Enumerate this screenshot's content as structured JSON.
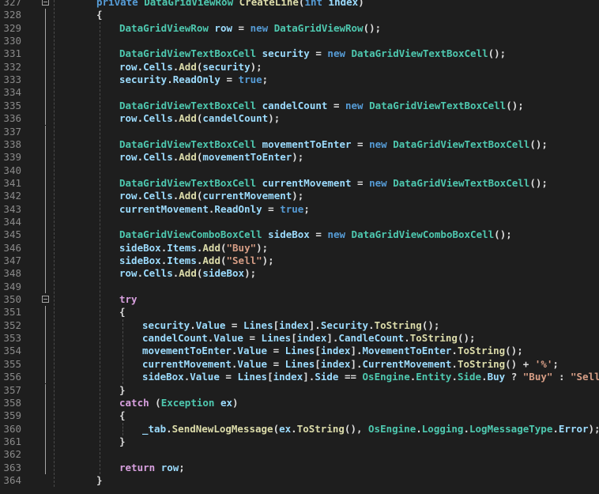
{
  "editor": {
    "language": "C#",
    "colors": {
      "background": "#1e1e1e",
      "line_number": "#8a8a8a",
      "type": "#4ec9b0",
      "keyword": "#569cd6",
      "control": "#d8a0df",
      "method": "#dcdcaa",
      "variable": "#9cdcfe",
      "string": "#d69d85",
      "plain": "#dcdcdc"
    },
    "line_numbers": [
      "327",
      "328",
      "329",
      "330",
      "331",
      "332",
      "333",
      "334",
      "335",
      "336",
      "337",
      "338",
      "339",
      "340",
      "341",
      "342",
      "343",
      "344",
      "345",
      "346",
      "347",
      "348",
      "349",
      "350",
      "351",
      "352",
      "353",
      "354",
      "355",
      "356",
      "357",
      "358",
      "359",
      "360",
      "361",
      "362",
      "363",
      "364"
    ],
    "fold_markers": [
      "327",
      "350"
    ],
    "lines": [
      [
        [
          "kw",
          "private "
        ],
        [
          "type",
          "DataGridViewRow "
        ],
        [
          "method",
          "CreateLine"
        ],
        [
          "plain",
          "("
        ],
        [
          "kw",
          "int "
        ],
        [
          "var",
          "index"
        ],
        [
          "plain",
          ")"
        ]
      ],
      [
        [
          "plain",
          "{"
        ]
      ],
      [
        [
          "type",
          "DataGridViewRow "
        ],
        [
          "var",
          "row "
        ],
        [
          "plain",
          "= "
        ],
        [
          "kw",
          "new "
        ],
        [
          "type",
          "DataGridViewRow"
        ],
        [
          "plain",
          "();"
        ]
      ],
      [],
      [
        [
          "type",
          "DataGridViewTextBoxCell "
        ],
        [
          "var",
          "security "
        ],
        [
          "plain",
          "= "
        ],
        [
          "kw",
          "new "
        ],
        [
          "type",
          "DataGridViewTextBoxCell"
        ],
        [
          "plain",
          "();"
        ]
      ],
      [
        [
          "var",
          "row"
        ],
        [
          "plain",
          "."
        ],
        [
          "var",
          "Cells"
        ],
        [
          "plain",
          "."
        ],
        [
          "method",
          "Add"
        ],
        [
          "plain",
          "("
        ],
        [
          "var",
          "security"
        ],
        [
          "plain",
          ");"
        ]
      ],
      [
        [
          "var",
          "security"
        ],
        [
          "plain",
          "."
        ],
        [
          "var",
          "ReadOnly "
        ],
        [
          "plain",
          "= "
        ],
        [
          "kw",
          "true"
        ],
        [
          "plain",
          ";"
        ]
      ],
      [],
      [
        [
          "type",
          "DataGridViewTextBoxCell "
        ],
        [
          "var",
          "candelCount "
        ],
        [
          "plain",
          "= "
        ],
        [
          "kw",
          "new "
        ],
        [
          "type",
          "DataGridViewTextBoxCell"
        ],
        [
          "plain",
          "();"
        ]
      ],
      [
        [
          "var",
          "row"
        ],
        [
          "plain",
          "."
        ],
        [
          "var",
          "Cells"
        ],
        [
          "plain",
          "."
        ],
        [
          "method",
          "Add"
        ],
        [
          "plain",
          "("
        ],
        [
          "var",
          "candelCount"
        ],
        [
          "plain",
          ");"
        ]
      ],
      [],
      [
        [
          "type",
          "DataGridViewTextBoxCell "
        ],
        [
          "var",
          "movementToEnter "
        ],
        [
          "plain",
          "= "
        ],
        [
          "kw",
          "new "
        ],
        [
          "type",
          "DataGridViewTextBoxCell"
        ],
        [
          "plain",
          "();"
        ]
      ],
      [
        [
          "var",
          "row"
        ],
        [
          "plain",
          "."
        ],
        [
          "var",
          "Cells"
        ],
        [
          "plain",
          "."
        ],
        [
          "method",
          "Add"
        ],
        [
          "plain",
          "("
        ],
        [
          "var",
          "movementToEnter"
        ],
        [
          "plain",
          ");"
        ]
      ],
      [],
      [
        [
          "type",
          "DataGridViewTextBoxCell "
        ],
        [
          "var",
          "currentMovement "
        ],
        [
          "plain",
          "= "
        ],
        [
          "kw",
          "new "
        ],
        [
          "type",
          "DataGridViewTextBoxCell"
        ],
        [
          "plain",
          "();"
        ]
      ],
      [
        [
          "var",
          "row"
        ],
        [
          "plain",
          "."
        ],
        [
          "var",
          "Cells"
        ],
        [
          "plain",
          "."
        ],
        [
          "method",
          "Add"
        ],
        [
          "plain",
          "("
        ],
        [
          "var",
          "currentMovement"
        ],
        [
          "plain",
          ");"
        ]
      ],
      [
        [
          "var",
          "currentMovement"
        ],
        [
          "plain",
          "."
        ],
        [
          "var",
          "ReadOnly "
        ],
        [
          "plain",
          "= "
        ],
        [
          "kw",
          "true"
        ],
        [
          "plain",
          ";"
        ]
      ],
      [],
      [
        [
          "type",
          "DataGridViewComboBoxCell "
        ],
        [
          "var",
          "sideBox "
        ],
        [
          "plain",
          "= "
        ],
        [
          "kw",
          "new "
        ],
        [
          "type",
          "DataGridViewComboBoxCell"
        ],
        [
          "plain",
          "();"
        ]
      ],
      [
        [
          "var",
          "sideBox"
        ],
        [
          "plain",
          "."
        ],
        [
          "var",
          "Items"
        ],
        [
          "plain",
          "."
        ],
        [
          "method",
          "Add"
        ],
        [
          "plain",
          "("
        ],
        [
          "str",
          "\"Buy\""
        ],
        [
          "plain",
          ");"
        ]
      ],
      [
        [
          "var",
          "sideBox"
        ],
        [
          "plain",
          "."
        ],
        [
          "var",
          "Items"
        ],
        [
          "plain",
          "."
        ],
        [
          "method",
          "Add"
        ],
        [
          "plain",
          "("
        ],
        [
          "str",
          "\"Sell\""
        ],
        [
          "plain",
          ");"
        ]
      ],
      [
        [
          "var",
          "row"
        ],
        [
          "plain",
          "."
        ],
        [
          "var",
          "Cells"
        ],
        [
          "plain",
          "."
        ],
        [
          "method",
          "Add"
        ],
        [
          "plain",
          "("
        ],
        [
          "var",
          "sideBox"
        ],
        [
          "plain",
          ");"
        ]
      ],
      [],
      [
        [
          "ctrl",
          "try"
        ]
      ],
      [
        [
          "plain",
          "{"
        ]
      ],
      [
        [
          "var",
          "security"
        ],
        [
          "plain",
          "."
        ],
        [
          "var",
          "Value "
        ],
        [
          "plain",
          "= "
        ],
        [
          "var",
          "Lines"
        ],
        [
          "plain",
          "["
        ],
        [
          "var",
          "index"
        ],
        [
          "plain",
          "]."
        ],
        [
          "var",
          "Security"
        ],
        [
          "plain",
          "."
        ],
        [
          "method",
          "ToString"
        ],
        [
          "plain",
          "();"
        ]
      ],
      [
        [
          "var",
          "candelCount"
        ],
        [
          "plain",
          "."
        ],
        [
          "var",
          "Value "
        ],
        [
          "plain",
          "= "
        ],
        [
          "var",
          "Lines"
        ],
        [
          "plain",
          "["
        ],
        [
          "var",
          "index"
        ],
        [
          "plain",
          "]."
        ],
        [
          "var",
          "CandleCount"
        ],
        [
          "plain",
          "."
        ],
        [
          "method",
          "ToString"
        ],
        [
          "plain",
          "();"
        ]
      ],
      [
        [
          "var",
          "movementToEnter"
        ],
        [
          "plain",
          "."
        ],
        [
          "var",
          "Value "
        ],
        [
          "plain",
          "= "
        ],
        [
          "var",
          "Lines"
        ],
        [
          "plain",
          "["
        ],
        [
          "var",
          "index"
        ],
        [
          "plain",
          "]."
        ],
        [
          "var",
          "MovementToEnter"
        ],
        [
          "plain",
          "."
        ],
        [
          "method",
          "ToString"
        ],
        [
          "plain",
          "();"
        ]
      ],
      [
        [
          "var",
          "currentMovement"
        ],
        [
          "plain",
          "."
        ],
        [
          "var",
          "Value "
        ],
        [
          "plain",
          "= "
        ],
        [
          "var",
          "Lines"
        ],
        [
          "plain",
          "["
        ],
        [
          "var",
          "index"
        ],
        [
          "plain",
          "]."
        ],
        [
          "var",
          "CurrentMovement"
        ],
        [
          "plain",
          "."
        ],
        [
          "method",
          "ToString"
        ],
        [
          "plain",
          "() + "
        ],
        [
          "str",
          "'%'"
        ],
        [
          "plain",
          ";"
        ]
      ],
      [
        [
          "var",
          "sideBox"
        ],
        [
          "plain",
          "."
        ],
        [
          "var",
          "Value "
        ],
        [
          "plain",
          "= "
        ],
        [
          "var",
          "Lines"
        ],
        [
          "plain",
          "["
        ],
        [
          "var",
          "index"
        ],
        [
          "plain",
          "]."
        ],
        [
          "var",
          "Side "
        ],
        [
          "plain",
          "== "
        ],
        [
          "type",
          "OsEngine"
        ],
        [
          "plain",
          "."
        ],
        [
          "type",
          "Entity"
        ],
        [
          "plain",
          "."
        ],
        [
          "type",
          "Side"
        ],
        [
          "plain",
          "."
        ],
        [
          "var",
          "Buy "
        ],
        [
          "plain",
          "? "
        ],
        [
          "str",
          "\"Buy\" "
        ],
        [
          "plain",
          ": "
        ],
        [
          "str",
          "\"Sell\""
        ],
        [
          "plain",
          ";"
        ]
      ],
      [
        [
          "plain",
          "}"
        ]
      ],
      [
        [
          "ctrl",
          "catch "
        ],
        [
          "plain",
          "("
        ],
        [
          "type",
          "Exception "
        ],
        [
          "var",
          "ex"
        ],
        [
          "plain",
          ")"
        ]
      ],
      [
        [
          "plain",
          "{"
        ]
      ],
      [
        [
          "var",
          "_tab"
        ],
        [
          "plain",
          "."
        ],
        [
          "method",
          "SendNewLogMessage"
        ],
        [
          "plain",
          "("
        ],
        [
          "var",
          "ex"
        ],
        [
          "plain",
          "."
        ],
        [
          "method",
          "ToString"
        ],
        [
          "plain",
          "(), "
        ],
        [
          "type",
          "OsEngine"
        ],
        [
          "plain",
          "."
        ],
        [
          "type",
          "Logging"
        ],
        [
          "plain",
          "."
        ],
        [
          "type",
          "LogMessageType"
        ],
        [
          "plain",
          "."
        ],
        [
          "var",
          "Error"
        ],
        [
          "plain",
          ");"
        ]
      ],
      [
        [
          "plain",
          "}"
        ]
      ],
      [],
      [
        [
          "ctrl",
          "return "
        ],
        [
          "var",
          "row"
        ],
        [
          "plain",
          ";"
        ]
      ],
      [
        [
          "plain",
          "}"
        ]
      ]
    ]
  }
}
